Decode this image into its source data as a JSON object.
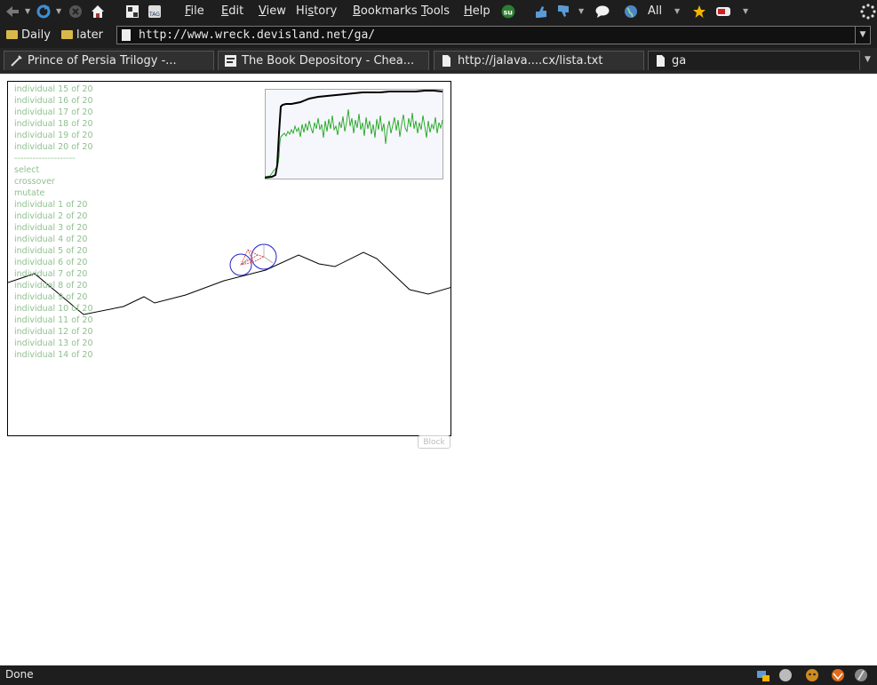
{
  "menubar": {
    "items": [
      "File",
      "Edit",
      "View",
      "History",
      "Bookmarks",
      "Tools",
      "Help"
    ],
    "accel": [
      "F",
      "E",
      "V",
      "s",
      "B",
      "T",
      "H"
    ],
    "search_engine": "All"
  },
  "navbar": {
    "bookmarks": [
      "Daily",
      "later"
    ],
    "url": "http://www.wreck.devisland.net/ga/"
  },
  "tabs": [
    {
      "label": "Prince of Persia Trilogy -..."
    },
    {
      "label": "The Book Depository - Chea..."
    },
    {
      "label": "http://jalava....cx/lista.txt"
    },
    {
      "label": "ga"
    }
  ],
  "ga": {
    "log_lines": [
      "individual 15 of 20",
      "individual 16 of 20",
      "individual 17 of 20",
      "individual 18 of 20",
      "individual 19 of 20",
      "individual 20 of 20",
      "--------------------",
      "select",
      "crossover",
      "mutate",
      "individual 1 of 20",
      "individual 2 of 20",
      "individual 3 of 20",
      "individual 4 of 20",
      "individual 5 of 20",
      "individual 6 of 20",
      "individual 7 of 20",
      "individual 8 of 20",
      "individual 9 of 20",
      "individual 10 of 20",
      "individual 11 of 20",
      "individual 12 of 20",
      "individual 13 of 20",
      "individual 14 of 20"
    ],
    "block_label": "Block",
    "colors": {
      "log_text": "#8fbf8f",
      "best": "#000000",
      "average": "#1fa51f",
      "wheel": "#2222cc"
    }
  },
  "status": {
    "text": "Done"
  }
}
